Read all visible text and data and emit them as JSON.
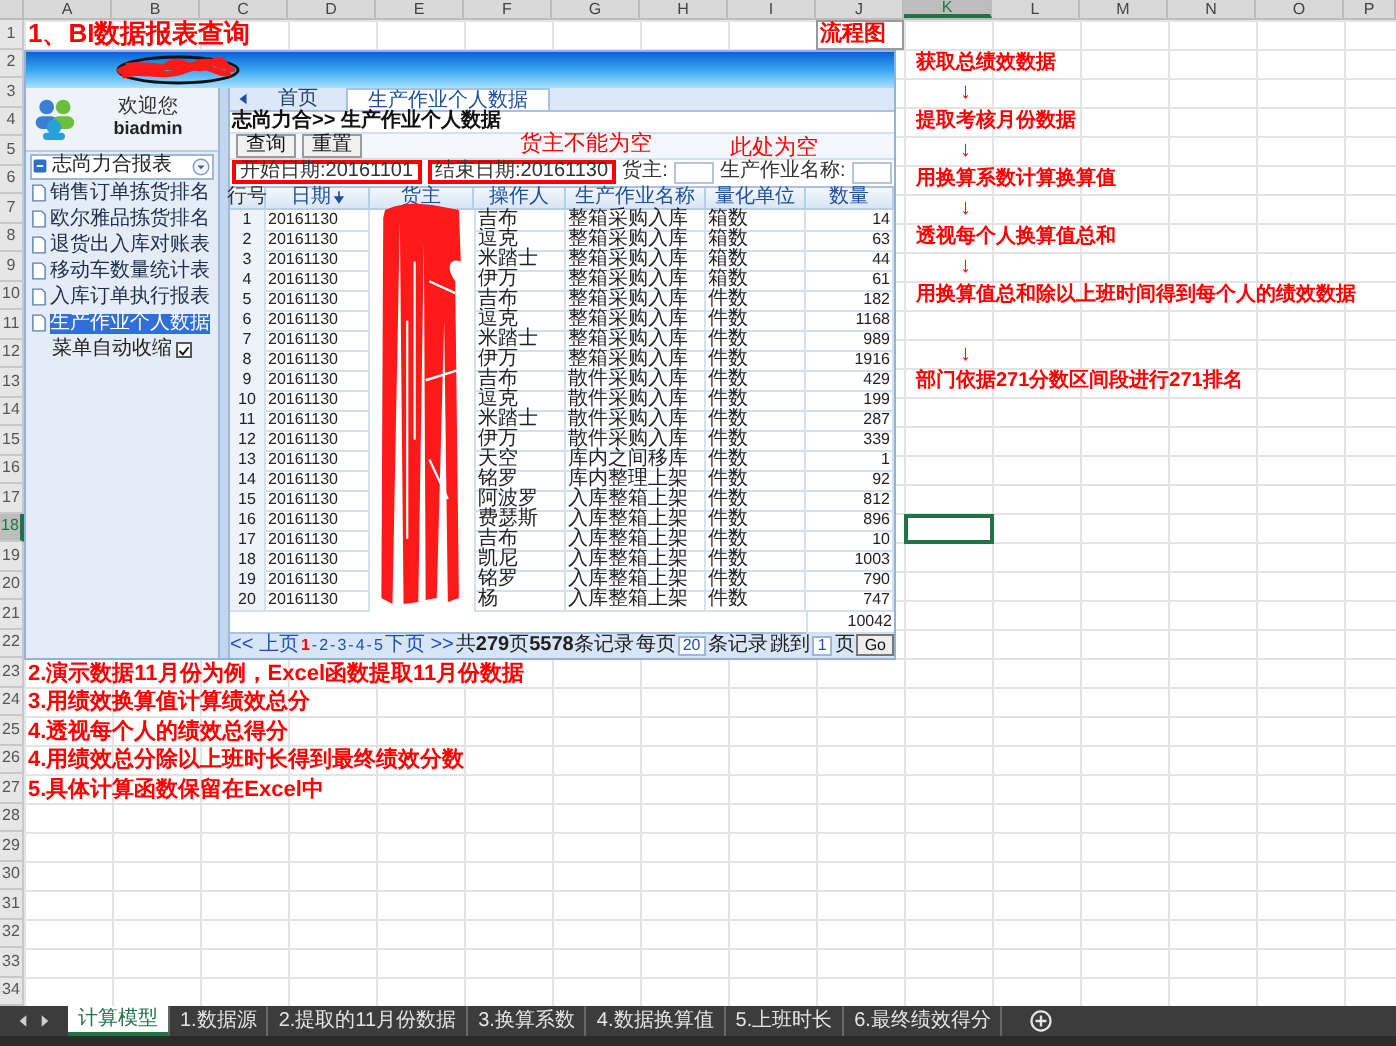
{
  "sheet": {
    "column_headers": [
      {
        "label": "A",
        "selected": false
      },
      {
        "label": "B",
        "selected": false
      },
      {
        "label": "C",
        "selected": false
      },
      {
        "label": "D",
        "selected": false
      },
      {
        "label": "E",
        "selected": false
      },
      {
        "label": "F",
        "selected": false
      },
      {
        "label": "G",
        "selected": false
      },
      {
        "label": "H",
        "selected": false
      },
      {
        "label": "I",
        "selected": false
      },
      {
        "label": "J",
        "selected": false
      },
      {
        "label": "K",
        "selected": true
      },
      {
        "label": "L",
        "selected": false
      },
      {
        "label": "M",
        "selected": false
      },
      {
        "label": "N",
        "selected": false
      },
      {
        "label": "O",
        "selected": false
      },
      {
        "label": "P",
        "selected": false
      }
    ],
    "row_headers": [
      {
        "label": "1",
        "selected": false
      },
      {
        "label": "2",
        "selected": false
      },
      {
        "label": "3",
        "selected": false
      },
      {
        "label": "4",
        "selected": false
      },
      {
        "label": "5",
        "selected": false
      },
      {
        "label": "6",
        "selected": false
      },
      {
        "label": "7",
        "selected": false
      },
      {
        "label": "8",
        "selected": false
      },
      {
        "label": "9",
        "selected": false
      },
      {
        "label": "10",
        "selected": false
      },
      {
        "label": "11",
        "selected": false
      },
      {
        "label": "12",
        "selected": false
      },
      {
        "label": "13",
        "selected": false
      },
      {
        "label": "14",
        "selected": false
      },
      {
        "label": "15",
        "selected": false
      },
      {
        "label": "16",
        "selected": false
      },
      {
        "label": "17",
        "selected": false
      },
      {
        "label": "18",
        "selected": true
      },
      {
        "label": "19",
        "selected": false
      },
      {
        "label": "20",
        "selected": false
      },
      {
        "label": "21",
        "selected": false
      },
      {
        "label": "22",
        "selected": false
      },
      {
        "label": "23",
        "selected": false
      },
      {
        "label": "24",
        "selected": false
      },
      {
        "label": "25",
        "selected": false
      },
      {
        "label": "26",
        "selected": false
      },
      {
        "label": "27",
        "selected": false
      },
      {
        "label": "28",
        "selected": false
      },
      {
        "label": "29",
        "selected": false
      },
      {
        "label": "30",
        "selected": false
      },
      {
        "label": "31",
        "selected": false
      },
      {
        "label": "32",
        "selected": false
      },
      {
        "label": "33",
        "selected": false
      },
      {
        "label": "34",
        "selected": false
      }
    ]
  },
  "title": "1、BI数据报表查询",
  "flow": {
    "title": "流程图",
    "steps": [
      {
        "kind": "step",
        "text": "获取总绩效数据",
        "gap_before": false
      },
      {
        "kind": "arrow",
        "text": "↓",
        "gap_before": false
      },
      {
        "kind": "step",
        "text": "提取考核月份数据",
        "gap_before": false
      },
      {
        "kind": "arrow",
        "text": "↓",
        "gap_before": false
      },
      {
        "kind": "step",
        "text": "用换算系数计算换算值",
        "gap_before": false
      },
      {
        "kind": "arrow",
        "text": "↓",
        "gap_before": false
      },
      {
        "kind": "step",
        "text": "透视每个人换算值总和",
        "gap_before": false
      },
      {
        "kind": "arrow",
        "text": "↓",
        "gap_before": false
      },
      {
        "kind": "step",
        "text": "用换算值总和除以上班时间得到每个人的绩效数据",
        "gap_before": false
      },
      {
        "kind": "arrow",
        "text": "↓",
        "gap_before": true
      },
      {
        "kind": "step",
        "text": "部门依据271分数区间段进行271排名",
        "gap_before": false
      }
    ]
  },
  "app": {
    "user": {
      "greeting": "欢迎您",
      "name": "biadmin"
    },
    "report_dropdown": "志尚力合报表",
    "menu": [
      {
        "label": "销售订单拣货排名",
        "selected": false
      },
      {
        "label": "欧尔雅品拣货排名",
        "selected": false
      },
      {
        "label": "退货出入库对账表",
        "selected": false
      },
      {
        "label": "移动车数量统计表",
        "selected": false
      },
      {
        "label": "入库订单执行报表",
        "selected": false
      },
      {
        "label": "生产作业个人数据",
        "selected": true
      }
    ],
    "auto_collapse": {
      "label": "菜单自动收缩",
      "checked": true
    },
    "tabs": [
      {
        "label": "首页",
        "selected": false
      },
      {
        "label": "生产作业个人数据",
        "selected": true
      }
    ],
    "breadcrumb": "志尚力合>> 生产作业个人数据",
    "buttons": [
      "查询",
      "重置"
    ],
    "annotations": [
      "货主不能为空",
      "此处为空"
    ],
    "filters": [
      {
        "kind": "filled",
        "text": "开始日期:20161101",
        "highlighted": true
      },
      {
        "kind": "filled",
        "text": "结束日期:20161130",
        "highlighted": true
      },
      {
        "kind": "labeled",
        "text": "货主:",
        "highlighted": false
      },
      {
        "kind": "labeled",
        "text": "生产作业名称:",
        "highlighted": false
      }
    ],
    "table": {
      "columns": [
        {
          "label": "行号",
          "sorted": false
        },
        {
          "label": "日期",
          "sorted": true
        },
        {
          "label": "货主",
          "sorted": false
        },
        {
          "label": "操作人",
          "sorted": false
        },
        {
          "label": "生产作业名称",
          "sorted": false
        },
        {
          "label": "量化单位",
          "sorted": false
        },
        {
          "label": "数量",
          "sorted": false
        }
      ],
      "rows": [
        {
          "no": "1",
          "date": "20161130",
          "operator": "吉布",
          "operation": "整箱采购入库",
          "unit": "箱数",
          "qty": "14"
        },
        {
          "no": "2",
          "date": "20161130",
          "operator": "逗克",
          "operation": "整箱采购入库",
          "unit": "箱数",
          "qty": "63"
        },
        {
          "no": "3",
          "date": "20161130",
          "operator": "米踏士",
          "operation": "整箱采购入库",
          "unit": "箱数",
          "qty": "44"
        },
        {
          "no": "4",
          "date": "20161130",
          "operator": "伊万",
          "operation": "整箱采购入库",
          "unit": "箱数",
          "qty": "61"
        },
        {
          "no": "5",
          "date": "20161130",
          "operator": "吉布",
          "operation": "整箱采购入库",
          "unit": "件数",
          "qty": "182"
        },
        {
          "no": "6",
          "date": "20161130",
          "operator": "逗克",
          "operation": "整箱采购入库",
          "unit": "件数",
          "qty": "1168"
        },
        {
          "no": "7",
          "date": "20161130",
          "operator": "米踏士",
          "operation": "整箱采购入库",
          "unit": "件数",
          "qty": "989"
        },
        {
          "no": "8",
          "date": "20161130",
          "operator": "伊万",
          "operation": "整箱采购入库",
          "unit": "件数",
          "qty": "1916"
        },
        {
          "no": "9",
          "date": "20161130",
          "operator": "吉布",
          "operation": "散件采购入库",
          "unit": "件数",
          "qty": "429"
        },
        {
          "no": "10",
          "date": "20161130",
          "operator": "逗克",
          "operation": "散件采购入库",
          "unit": "件数",
          "qty": "199"
        },
        {
          "no": "11",
          "date": "20161130",
          "operator": "米踏士",
          "operation": "散件采购入库",
          "unit": "件数",
          "qty": "287"
        },
        {
          "no": "12",
          "date": "20161130",
          "operator": "伊万",
          "operation": "散件采购入库",
          "unit": "件数",
          "qty": "339"
        },
        {
          "no": "13",
          "date": "20161130",
          "operator": "天空",
          "operation": "库内之间移库",
          "unit": "件数",
          "qty": "1"
        },
        {
          "no": "14",
          "date": "20161130",
          "operator": "铭罗",
          "operation": "库内整理上架",
          "unit": "件数",
          "qty": "92"
        },
        {
          "no": "15",
          "date": "20161130",
          "operator": "阿波罗",
          "operation": "入库整箱上架",
          "unit": "件数",
          "qty": "812"
        },
        {
          "no": "16",
          "date": "20161130",
          "operator": "费瑟斯",
          "operation": "入库整箱上架",
          "unit": "件数",
          "qty": "896"
        },
        {
          "no": "17",
          "date": "20161130",
          "operator": "吉布",
          "operation": "入库整箱上架",
          "unit": "件数",
          "qty": "10"
        },
        {
          "no": "18",
          "date": "20161130",
          "operator": "凯尼",
          "operation": "入库整箱上架",
          "unit": "件数",
          "qty": "1003"
        },
        {
          "no": "19",
          "date": "20161130",
          "operator": "铭罗",
          "operation": "入库整箱上架",
          "unit": "件数",
          "qty": "790"
        },
        {
          "no": "20",
          "date": "20161130",
          "operator": "杨",
          "operation": "入库整箱上架",
          "unit": "件数",
          "qty": "747"
        }
      ],
      "total": "10042"
    },
    "pager": {
      "prev": "<< 上页",
      "pages": [
        {
          "label": "1",
          "selected": true
        },
        {
          "label": "2",
          "selected": false
        },
        {
          "label": "3",
          "selected": false
        },
        {
          "label": "4",
          "selected": false
        },
        {
          "label": "5",
          "selected": false
        }
      ],
      "separators": [
        "-",
        "-",
        "-",
        "-"
      ],
      "next": "下页 >>",
      "summary": "共**279**页**5578**条记录",
      "per_page_label": "每页",
      "per_page": "20",
      "per_page_unit": "条记录",
      "jump_label": "跳到",
      "jump_value": "1",
      "jump_unit": "页",
      "go": "Go"
    }
  },
  "notes": [
    "2.演示数据11月份为例，Excel函数提取11月份数据",
    "3.用绩效换算值计算绩效总分",
    "4.透视每个人的绩效总得分",
    "4.用绩效总分除以上班时长得到最终绩效分数",
    "5.具体计算函数保留在Excel中"
  ],
  "sheet_tabs": [
    {
      "label": "计算模型",
      "selected": true
    },
    {
      "label": "1.数据源",
      "selected": false
    },
    {
      "label": "2.提取的11月份数据",
      "selected": false
    },
    {
      "label": "3.换算系数",
      "selected": false
    },
    {
      "label": "4.数据换算值",
      "selected": false
    },
    {
      "label": "5.上班时长",
      "selected": false
    },
    {
      "label": "6.最终绩效得分",
      "selected": false
    }
  ]
}
